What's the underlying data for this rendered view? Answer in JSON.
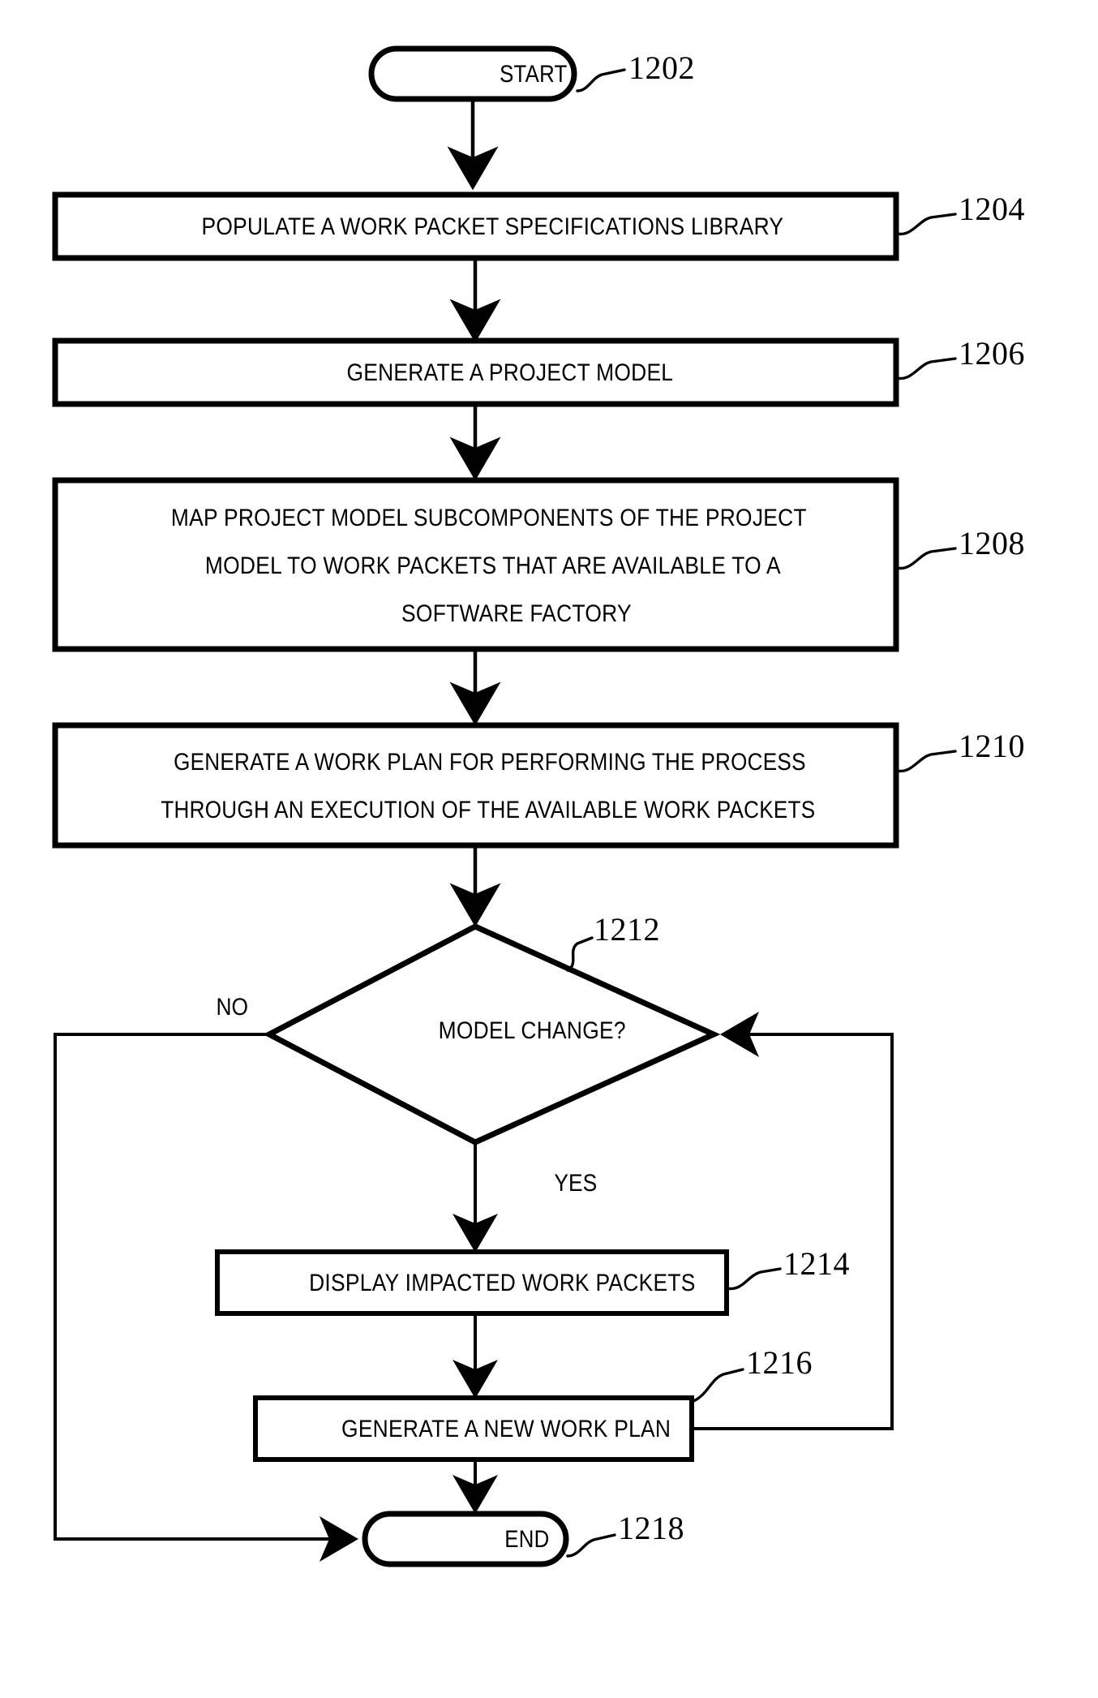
{
  "figure": {
    "type": "patent-flowchart",
    "background_color": "#ffffff",
    "line_color": "#000000"
  },
  "nodes": {
    "start": {
      "label": "START",
      "shape": "terminator",
      "ref": "1202"
    },
    "populate_library": {
      "label": "POPULATE A WORK PACKET SPECIFICATIONS LIBRARY",
      "shape": "process",
      "ref": "1204"
    },
    "generate_project_model": {
      "label": "GENERATE A PROJECT MODEL",
      "shape": "process",
      "ref": "1206"
    },
    "map_subcomponents": {
      "label_line1": "MAP PROJECT MODEL SUBCOMPONENTS OF THE PROJECT",
      "label_line2": "MODEL TO WORK PACKETS THAT ARE AVAILABLE TO A",
      "label_line3": "SOFTWARE FACTORY",
      "shape": "process",
      "ref": "1208"
    },
    "generate_work_plan": {
      "label_line1": "GENERATE A WORK PLAN FOR PERFORMING THE PROCESS",
      "label_line2": "THROUGH AN EXECUTION OF THE AVAILABLE WORK PACKETS",
      "shape": "process",
      "ref": "1210"
    },
    "model_change": {
      "label": "MODEL CHANGE?",
      "shape": "decision",
      "ref": "1212",
      "branch_no": "NO",
      "branch_yes": "YES"
    },
    "display_impacted": {
      "label": "DISPLAY IMPACTED WORK PACKETS",
      "shape": "process",
      "ref": "1214"
    },
    "generate_new_plan": {
      "label": "GENERATE A NEW WORK PLAN",
      "shape": "process",
      "ref": "1216"
    },
    "end": {
      "label": "END",
      "shape": "terminator",
      "ref": "1218"
    }
  },
  "edges": [
    {
      "from": "start",
      "to": "populate_library",
      "label": ""
    },
    {
      "from": "populate_library",
      "to": "generate_project_model",
      "label": ""
    },
    {
      "from": "generate_project_model",
      "to": "map_subcomponents",
      "label": ""
    },
    {
      "from": "map_subcomponents",
      "to": "generate_work_plan",
      "label": ""
    },
    {
      "from": "generate_work_plan",
      "to": "model_change",
      "label": ""
    },
    {
      "from": "model_change",
      "to": "end",
      "label": "NO"
    },
    {
      "from": "model_change",
      "to": "display_impacted",
      "label": "YES"
    },
    {
      "from": "display_impacted",
      "to": "generate_new_plan",
      "label": ""
    },
    {
      "from": "generate_new_plan",
      "to": "end",
      "label": ""
    },
    {
      "from": "generate_new_plan",
      "to": "model_change",
      "label": ""
    }
  ]
}
